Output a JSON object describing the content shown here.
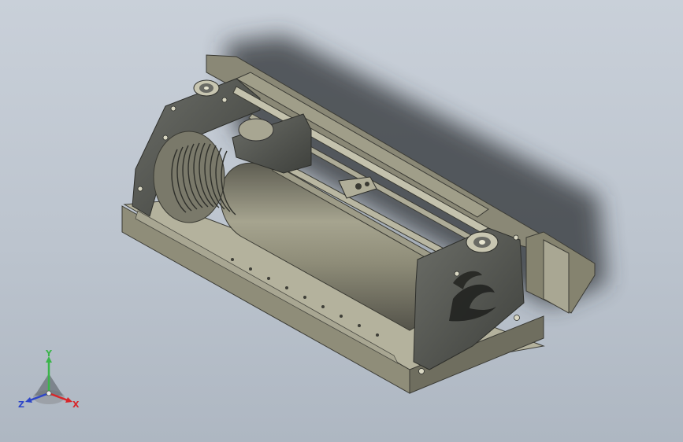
{
  "viewport": {
    "background_top": "#c9d0d9",
    "background_bottom": "#aeb7c2"
  },
  "model": {
    "body_color": "#9a9883",
    "frame_color": "#4f514c",
    "shadow_color": "#2d3136"
  },
  "triad": {
    "x_label": "X",
    "y_label": "Y",
    "z_label": "Z",
    "x_color": "#d8262a",
    "y_color": "#3bb54a",
    "z_color": "#2d46c8"
  }
}
